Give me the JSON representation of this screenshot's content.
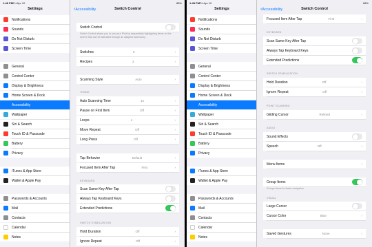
{
  "statusbar": {
    "time": "1:48 PM",
    "date": "Fri Apr 10",
    "battery": "88%"
  },
  "colors": {
    "accent": "#0a7aff",
    "toggle_on": "#34c759"
  },
  "settings_title": "Settings",
  "sidebar": [
    {
      "label": "Notifications",
      "icon": "notifications-icon",
      "color": "#ff3b30"
    },
    {
      "label": "Sounds",
      "icon": "sounds-icon",
      "color": "#ff2d55"
    },
    {
      "label": "Do Not Disturb",
      "icon": "moon-icon",
      "color": "#5856d6"
    },
    {
      "label": "Screen Time",
      "icon": "hourglass-icon",
      "color": "#5856d6"
    },
    {
      "label": "General",
      "icon": "gear-icon",
      "color": "#8e8e93"
    },
    {
      "label": "Control Center",
      "icon": "control-center-icon",
      "color": "#8e8e93"
    },
    {
      "label": "Display & Brightness",
      "icon": "display-icon",
      "color": "#0a7aff"
    },
    {
      "label": "Home Screen & Dock",
      "icon": "home-grid-icon",
      "color": "#0a7aff"
    },
    {
      "label": "Accessibility",
      "icon": "accessibility-icon",
      "color": "#0a7aff",
      "selected": true
    },
    {
      "label": "Wallpaper",
      "icon": "wallpaper-icon",
      "color": "#34aadc"
    },
    {
      "label": "Siri & Search",
      "icon": "siri-icon",
      "color": "#222"
    },
    {
      "label": "Touch ID & Passcode",
      "icon": "fingerprint-icon",
      "color": "#ff3b30"
    },
    {
      "label": "Battery",
      "icon": "battery-icon",
      "color": "#34c759"
    },
    {
      "label": "Privacy",
      "icon": "hand-icon",
      "color": "#0a7aff"
    },
    {
      "label": "iTunes & App Store",
      "icon": "app-store-icon",
      "color": "#0a7aff"
    },
    {
      "label": "Wallet & Apple Pay",
      "icon": "wallet-icon",
      "color": "#222"
    },
    {
      "label": "Passwords & Accounts",
      "icon": "key-icon",
      "color": "#8e8e93"
    },
    {
      "label": "Mail",
      "icon": "mail-icon",
      "color": "#0a7aff"
    },
    {
      "label": "Contacts",
      "icon": "contacts-icon",
      "color": "#8e8e93"
    },
    {
      "label": "Calendar",
      "icon": "calendar-icon",
      "color": "#fff"
    },
    {
      "label": "Notes",
      "icon": "notes-icon",
      "color": "#ffcc00"
    }
  ],
  "left_detail": {
    "back": "Accessibility",
    "title": "Switch Control",
    "switch_control": {
      "label": "Switch Control",
      "on": false
    },
    "description": "Switch Control allows you to use your iPad by sequentially highlighting items on the screen that can be activated through an adaptive accessory.",
    "rows1": [
      {
        "label": "Switches",
        "value": "0"
      },
      {
        "label": "Recipes",
        "value": "3"
      }
    ],
    "scanning_style": {
      "label": "Scanning Style",
      "value": "Auto"
    },
    "timing_header": "TIMING",
    "timing": [
      {
        "label": "Auto Scanning Time",
        "value": "1s"
      },
      {
        "label": "Pause on First Item",
        "value": "Off"
      },
      {
        "label": "Loops",
        "value": "4"
      },
      {
        "label": "Move Repeat",
        "value": "Off"
      },
      {
        "label": "Long Press",
        "value": "Off"
      }
    ],
    "tap": [
      {
        "label": "Tap Behavior",
        "value": "Default"
      },
      {
        "label": "Focused Item After Tap",
        "value": "First"
      }
    ],
    "keyboard_header": "KEYBOARD",
    "keyboard": [
      {
        "label": "Scan Same Key After Tap",
        "on": false
      },
      {
        "label": "Always Tap Keyboard Keys",
        "on": false
      },
      {
        "label": "Extended Predictions",
        "on": true
      }
    ],
    "stab_header": "SWITCH STABILIZATION",
    "stab": [
      {
        "label": "Hold Duration",
        "value": "Off"
      },
      {
        "label": "Ignore Repeat",
        "value": "Off"
      }
    ]
  },
  "right_detail": {
    "back": "Accessibility",
    "title": "Switch Control",
    "top": {
      "label": "Focused Item After Tap",
      "value": "First"
    },
    "keyboard_header": "KEYBOARD",
    "keyboard": [
      {
        "label": "Scan Same Key After Tap",
        "on": false
      },
      {
        "label": "Always Tap Keyboard Keys",
        "on": false
      },
      {
        "label": "Extended Predictions",
        "on": true
      }
    ],
    "stab_header": "SWITCH STABILIZATION",
    "stab": [
      {
        "label": "Hold Duration",
        "value": "Off"
      },
      {
        "label": "Ignore Repeat",
        "value": "Off"
      }
    ],
    "point_header": "POINT SCANNING",
    "gliding": {
      "label": "Gliding Cursor",
      "value": "Refined"
    },
    "audio_header": "AUDIO",
    "audio": [
      {
        "label": "Sound Effects",
        "on": false
      },
      {
        "label": "Speech",
        "value": "Off"
      }
    ],
    "menu_items": "Menu Items",
    "group_items": {
      "label": "Group Items",
      "on": true
    },
    "group_desc": "Groups items for faster navigation.",
    "visual_header": "VISUAL",
    "visual": [
      {
        "label": "Large Cursor",
        "on": false
      },
      {
        "label": "Cursor Color",
        "value": "Blue"
      }
    ],
    "saved": {
      "label": "Saved Gestures",
      "value": "None"
    }
  }
}
